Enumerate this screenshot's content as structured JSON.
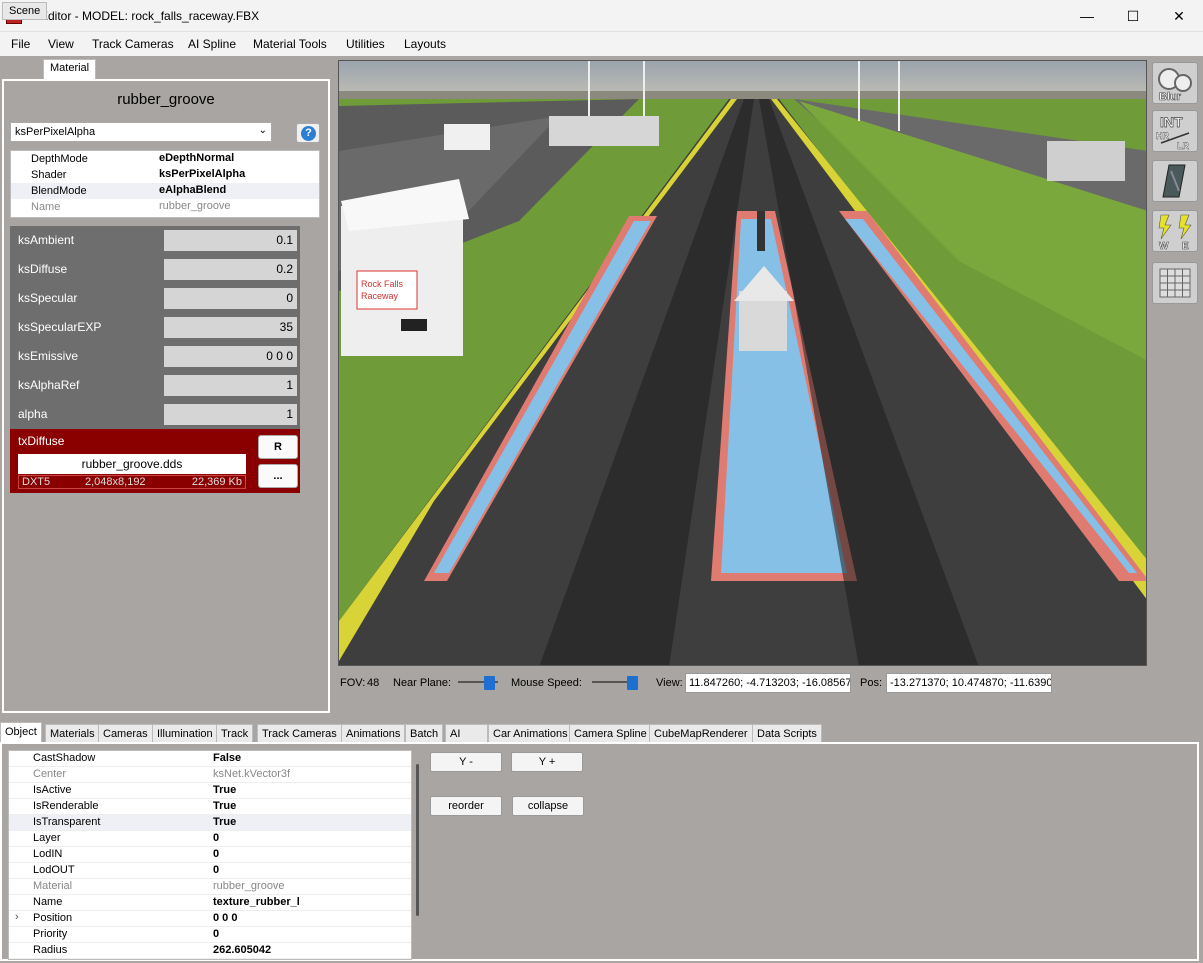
{
  "window": {
    "title": "ksEditor - MODEL: rock_falls_raceway.FBX",
    "controls": [
      "—",
      "☐",
      "✕"
    ]
  },
  "menu": [
    "File",
    "View",
    "Track Cameras",
    "AI Spline",
    "Material Tools",
    "Utilities",
    "Layouts"
  ],
  "left_tabs": [
    "Scene",
    "Material"
  ],
  "material": {
    "name": "rubber_groove",
    "shader_select": "ksPerPixelAlpha",
    "help": "?",
    "properties": [
      {
        "key": "DepthMode",
        "value": "eDepthNormal"
      },
      {
        "key": "Shader",
        "value": "ksPerPixelAlpha"
      },
      {
        "key": "BlendMode",
        "value": "eAlphaBlend"
      },
      {
        "key": "Name",
        "value": "rubber_groove"
      }
    ],
    "params": [
      {
        "key": "ksAmbient",
        "value": "0.1"
      },
      {
        "key": "ksDiffuse",
        "value": "0.2"
      },
      {
        "key": "ksSpecular",
        "value": "0"
      },
      {
        "key": "ksSpecularEXP",
        "value": "35"
      },
      {
        "key": "ksEmissive",
        "value": "0 0 0"
      },
      {
        "key": "ksAlphaRef",
        "value": "1"
      },
      {
        "key": "alpha",
        "value": "1"
      }
    ],
    "texture": {
      "label": "txDiffuse",
      "file": "rubber_groove.dds",
      "format": "DXT5",
      "dims": "2,048x8,192",
      "size": "22,369 Kb",
      "r_button": "R",
      "browse_button": "..."
    }
  },
  "viewport": {
    "sign_text_1": "Rock Falls",
    "sign_text_2": "Raceway"
  },
  "toolbar": {
    "blur": "Blur",
    "int": "INT",
    "hr": "HR",
    "lr": "LR",
    "w": "W",
    "e": "E"
  },
  "status": {
    "fov_label": "FOV:",
    "fov_value": "48",
    "near_plane_label": "Near Plane:",
    "mouse_speed_label": "Mouse Speed:",
    "view_label": "View:",
    "view_value": "11.847260; -4.713203; -16.08567",
    "pos_label": "Pos:",
    "pos_value": "-13.271370; 10.474870; -11.6390"
  },
  "bottom_tabs": [
    "Object",
    "Materials",
    "Cameras",
    "Illumination",
    "Track",
    "Track Cameras",
    "Animations",
    "Batch",
    "AI",
    "Car Animations",
    "Camera Spline",
    "CubeMapRenderer",
    "Data Scripts"
  ],
  "object_props": [
    {
      "key": "CastShadow",
      "value": "False"
    },
    {
      "key": "Center",
      "value": "ksNet.kVector3f"
    },
    {
      "key": "IsActive",
      "value": "True"
    },
    {
      "key": "IsRenderable",
      "value": "True"
    },
    {
      "key": "IsTransparent",
      "value": "True"
    },
    {
      "key": "Layer",
      "value": "0"
    },
    {
      "key": "LodIN",
      "value": "0"
    },
    {
      "key": "LodOUT",
      "value": "0"
    },
    {
      "key": "Material",
      "value": "rubber_groove"
    },
    {
      "key": "Name",
      "value": "texture_rubber_l"
    },
    {
      "key": "Position",
      "value": "0 0 0"
    },
    {
      "key": "Priority",
      "value": "0"
    },
    {
      "key": "Radius",
      "value": "262.605042"
    }
  ],
  "object_buttons": {
    "y_minus": "Y -",
    "y_plus": "Y +",
    "reorder": "reorder",
    "collapse": "collapse"
  }
}
